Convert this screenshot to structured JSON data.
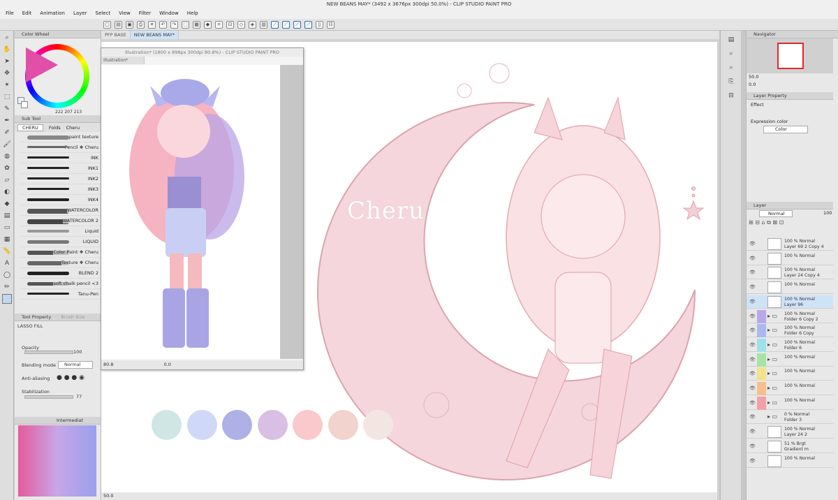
{
  "window": {
    "title": "NEW BEANS MAY* (3492 x 3676px 300dpi 50.0%) - CLIP STUDIO PAINT PRO"
  },
  "menu": [
    "File",
    "Edit",
    "Animation",
    "Layer",
    "Select",
    "View",
    "Filter",
    "Window",
    "Help"
  ],
  "color_wheel": {
    "title": "Color Wheel",
    "readout": "222  207  213",
    "main_color": "#e24fa8"
  },
  "sub_tool": {
    "title": "Sub Tool",
    "tab_active": "CHERU",
    "tab_folds": "Folds",
    "tab_more": "Cheru",
    "brushes": [
      "paint texture",
      "Pencil ❖ Cheru",
      "INK",
      "INK1",
      "INK2",
      "INK3",
      "INK4",
      "WATERCOLOR",
      "WATERCOLOR 2",
      "Liquid",
      "LIQUID",
      "Color Paint ❖ Cheru",
      "Texture ❖ Cheru",
      "BLEND 2",
      "soft chalk pencil <3",
      "Tanu-Pen"
    ]
  },
  "tool_property": {
    "title": "Tool Property",
    "tab2": "Brush Size",
    "tool_name": "LASSO FILL",
    "opacity_label": "Opacity",
    "opacity_value": "100",
    "blending_label": "Blending mode",
    "blending_value": "Normal",
    "antialias_label": "Anti-aliasing",
    "stabilization_label": "Stabilization",
    "stabilization_value": "77"
  },
  "color_set": {
    "title": "Intermediat"
  },
  "doc_tabs": [
    "PFP BASE",
    "NEW BEANS MAY*"
  ],
  "float_window": {
    "title": "Illustration* (1800 x 898px 300dpi 80.8%) - CLIP STUDIO PAINT PRO",
    "tab": "Illustration*",
    "zoom": "80.8",
    "rotation": "0.0"
  },
  "canvas": {
    "watermark": "Cheru",
    "zoom": "50.0",
    "palette_swatches": [
      "#cfe6e4",
      "#cfd8f7",
      "#aeb0e6",
      "#d8bfe3",
      "#f9c9cc",
      "#f2d3ce",
      "#f3e6e2"
    ]
  },
  "navigator": {
    "title": "Navigator",
    "zoom": "50.0",
    "rotation": "0.0"
  },
  "layer_property": {
    "title": "Layer Property",
    "effect_label": "Effect",
    "expression_label": "Expression color",
    "expression_value": "Color"
  },
  "layer_panel": {
    "title": "Layer",
    "blend_mode": "Normal",
    "opacity": "100",
    "layers": [
      {
        "l1": "100 % Normal",
        "l2": "Layer 69 2 Copy 4",
        "type": "layer",
        "color": ""
      },
      {
        "l1": "100 % Normal",
        "l2": "",
        "type": "layer",
        "color": ""
      },
      {
        "l1": "100 % Normal",
        "l2": "Layer 24 Copy 4",
        "type": "layer",
        "color": ""
      },
      {
        "l1": "100 % Normal",
        "l2": "",
        "type": "layer",
        "color": ""
      },
      {
        "l1": "100 % Normal",
        "l2": "Layer 96",
        "type": "layer",
        "color": ""
      },
      {
        "l1": "100 % Normal",
        "l2": "Folder 6 Copy 2",
        "type": "folder",
        "color": "#b9a8e8"
      },
      {
        "l1": "100 % Normal",
        "l2": "Folder 6 Copy",
        "type": "folder",
        "color": "#aab8ee"
      },
      {
        "l1": "100 % Normal",
        "l2": "Folder 6",
        "type": "folder",
        "color": "#9fe0e8"
      },
      {
        "l1": "100 % Normal",
        "l2": "",
        "type": "folder",
        "color": "#a9e3a3"
      },
      {
        "l1": "100 % Normal",
        "l2": "",
        "type": "folder",
        "color": "#f2e28e"
      },
      {
        "l1": "100 % Normal",
        "l2": "",
        "type": "folder",
        "color": "#f6c08c"
      },
      {
        "l1": "100 % Normal",
        "l2": "",
        "type": "folder",
        "color": "#f4a0a8"
      },
      {
        "l1": "0 % Normal",
        "l2": "Folder 3",
        "type": "folder",
        "color": ""
      },
      {
        "l1": "100 % Normal",
        "l2": "Layer 24 2",
        "type": "layer",
        "color": ""
      },
      {
        "l1": "51 % Brgt",
        "l2": "Gradient m",
        "type": "layer",
        "color": ""
      },
      {
        "l1": "100 % Normal",
        "l2": "",
        "type": "layer",
        "color": ""
      }
    ]
  }
}
